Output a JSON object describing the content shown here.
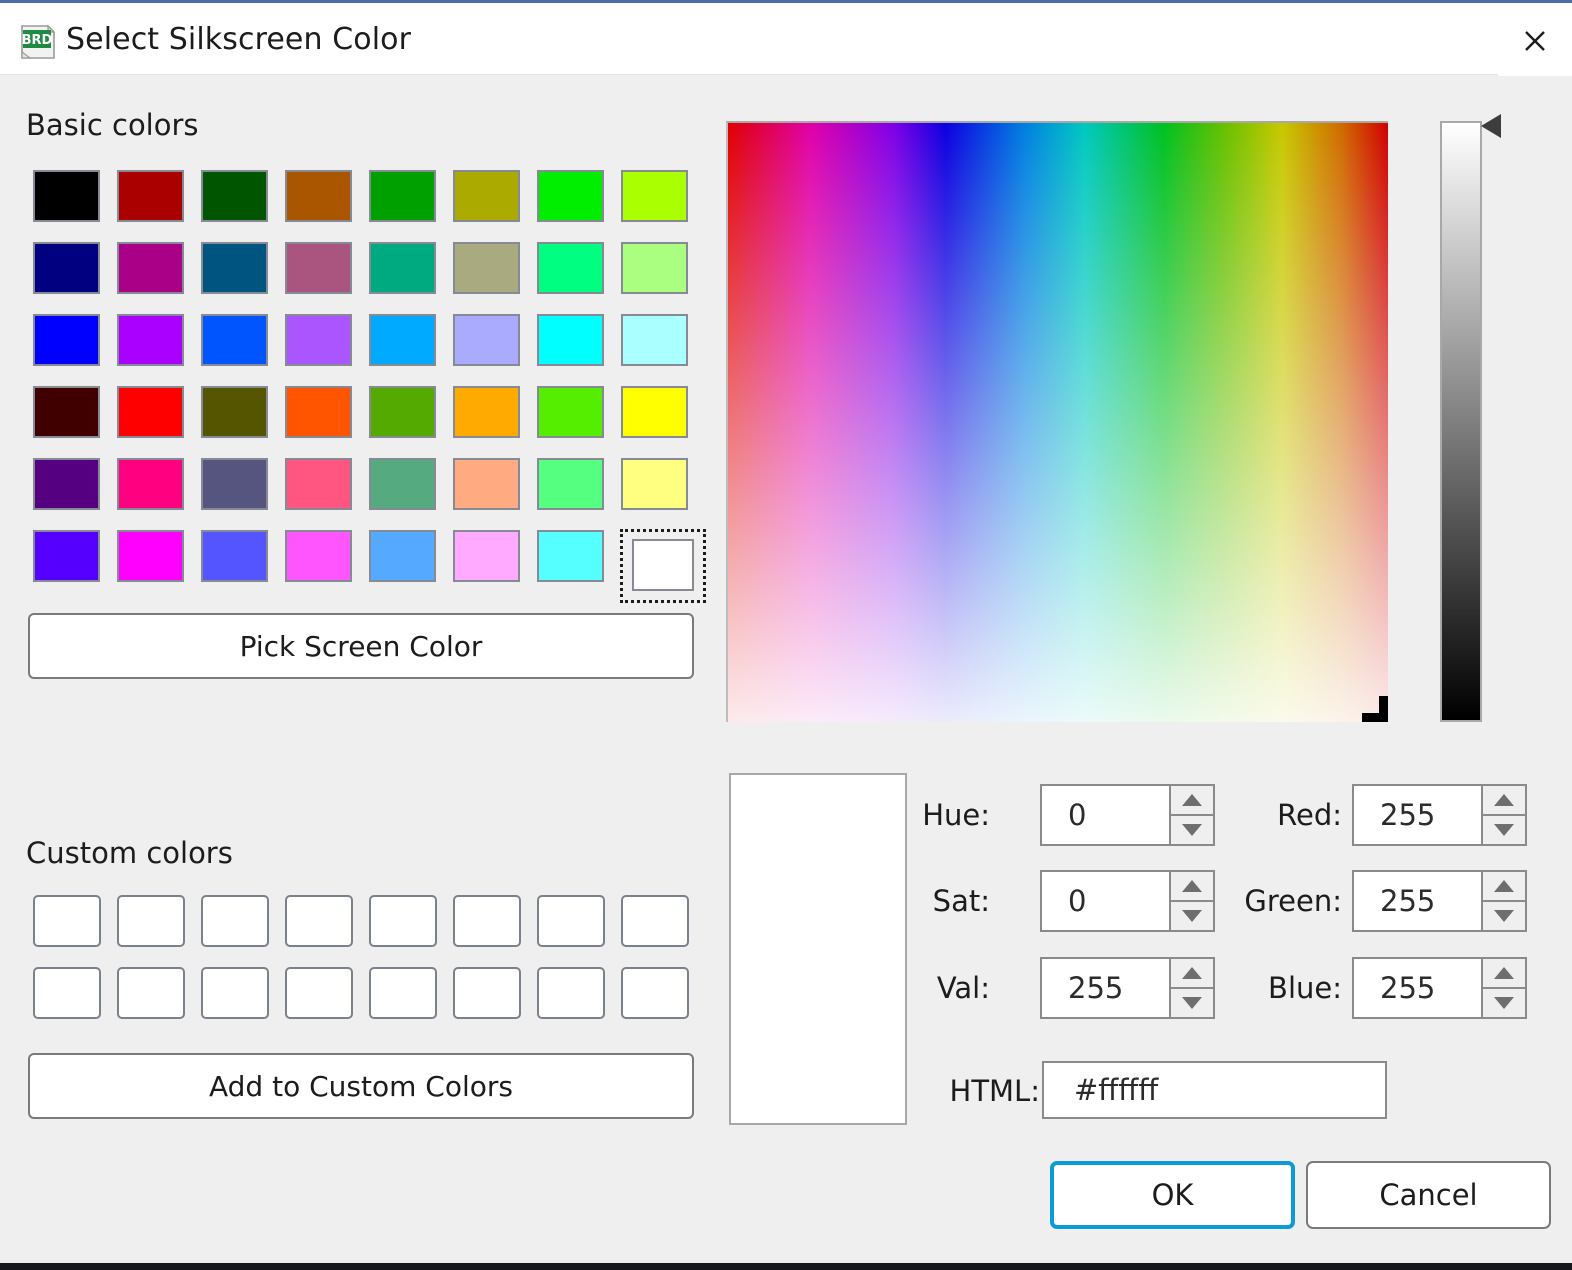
{
  "window": {
    "title": "Select Silkscreen Color",
    "icon": "brd-document-icon",
    "icon_label": "BRD",
    "close_icon": "close-icon",
    "accent_color": "#0b9bd9",
    "background_color": "#efefef"
  },
  "basic_colors": {
    "heading": "Basic colors",
    "rows": [
      [
        "#000000",
        "#aa0000",
        "#005500",
        "#aa5500",
        "#00a000",
        "#aaaa00",
        "#00ee00",
        "#aaff00"
      ],
      [
        "#000080",
        "#aa0088",
        "#005580",
        "#aa5580",
        "#00aa80",
        "#aaaa80",
        "#00ff80",
        "#aaff80"
      ],
      [
        "#0000ff",
        "#aa00ff",
        "#0055ff",
        "#aa55ff",
        "#00aaff",
        "#aaaaff",
        "#00ffff",
        "#aaffff"
      ],
      [
        "#400000",
        "#ff0000",
        "#555500",
        "#ff5500",
        "#55aa00",
        "#ffaa00",
        "#55ee00",
        "#ffff00"
      ],
      [
        "#550080",
        "#ff0080",
        "#555580",
        "#ff5580",
        "#55aa80",
        "#ffaa80",
        "#55ff80",
        "#ffff80"
      ],
      [
        "#5500ff",
        "#ff00ff",
        "#5555ff",
        "#ff55ff",
        "#55aaff",
        "#ffaaff",
        "#55ffff",
        "#ffffff"
      ]
    ],
    "selected_index": 47
  },
  "pick_screen_color": {
    "label": "Pick Screen Color"
  },
  "custom_colors": {
    "heading": "Custom colors",
    "count": 16,
    "empty_color": "#ffffff",
    "add_label": "Add to Custom Colors"
  },
  "picker": {
    "sv_area_name": "saturation-value-gradient",
    "value_slider_name": "value-slider",
    "preview_color": "#ffffff"
  },
  "fields": {
    "hue": {
      "label": "Hue:",
      "value": "0"
    },
    "sat": {
      "label": "Sat:",
      "value": "0"
    },
    "val": {
      "label": "Val:",
      "value": "255"
    },
    "red": {
      "label": "Red:",
      "value": "255"
    },
    "green": {
      "label": "Green:",
      "value": "255"
    },
    "blue": {
      "label": "Blue:",
      "value": "255"
    },
    "html": {
      "label": "HTML:",
      "value": "#ffffff"
    }
  },
  "buttons": {
    "ok": "OK",
    "cancel": "Cancel"
  }
}
